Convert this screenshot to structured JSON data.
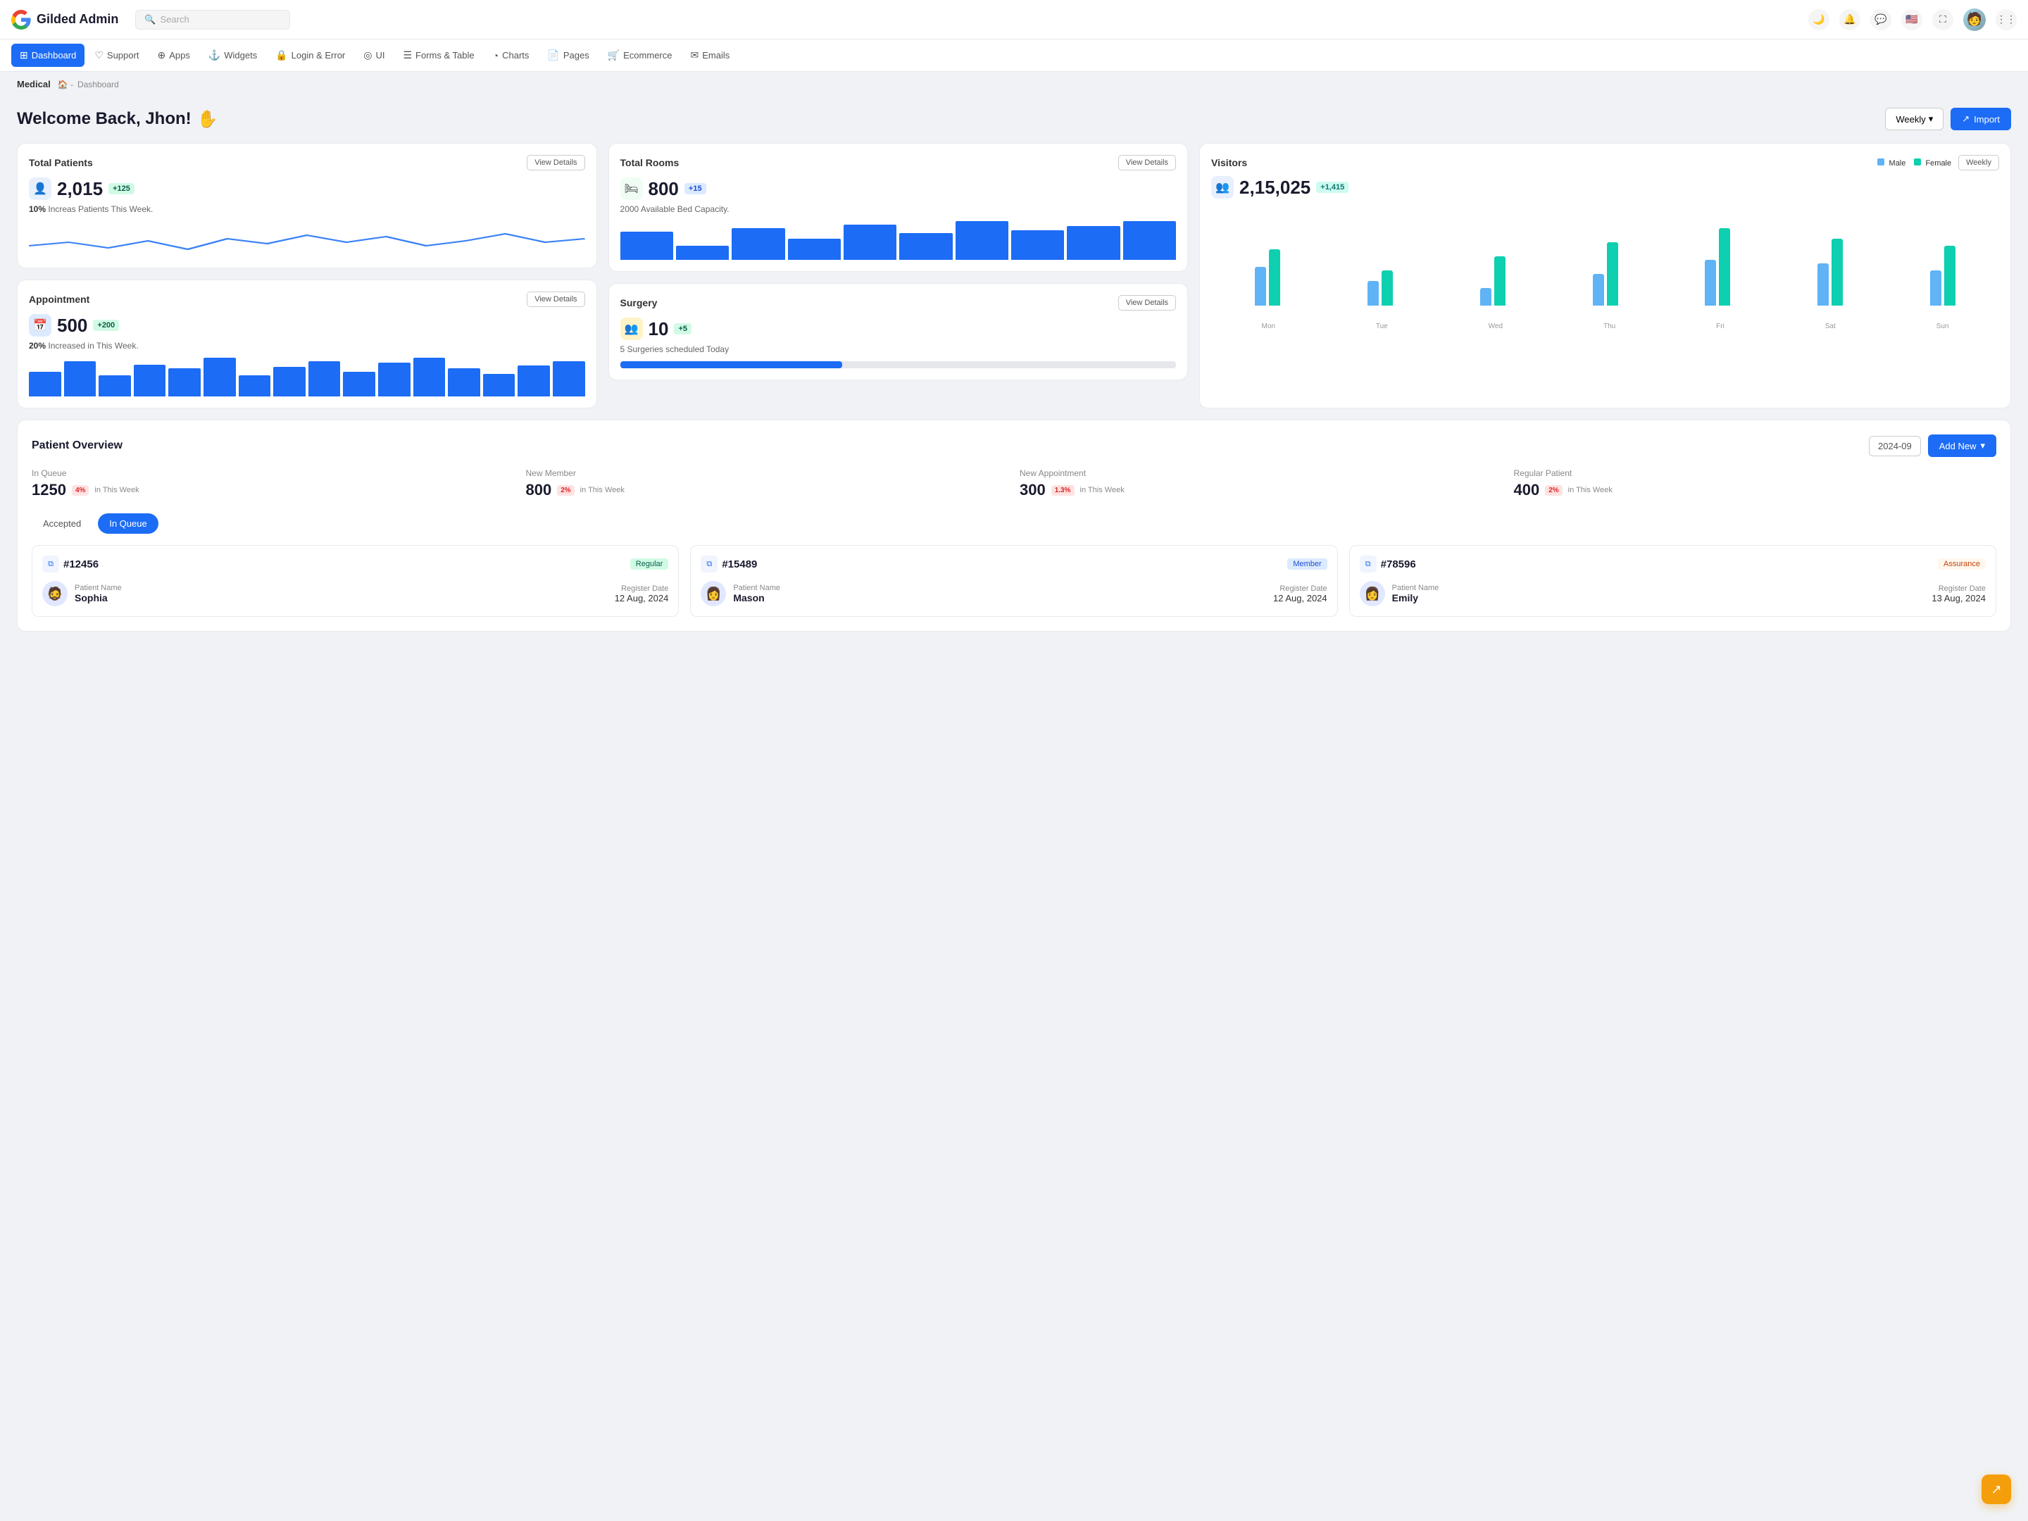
{
  "brand": {
    "name": "Gilded Admin"
  },
  "search": {
    "placeholder": "Search"
  },
  "navbar": {
    "icons": [
      "moon",
      "bell",
      "chat",
      "flag",
      "expand",
      "avatar",
      "grid"
    ]
  },
  "menu": {
    "items": [
      {
        "label": "Dashboard",
        "icon": "⊞",
        "active": true
      },
      {
        "label": "Support",
        "icon": "♡"
      },
      {
        "label": "Apps",
        "icon": "⊕"
      },
      {
        "label": "Widgets",
        "icon": "⚓"
      },
      {
        "label": "Login & Error",
        "icon": "🔒"
      },
      {
        "label": "UI",
        "icon": "◎"
      },
      {
        "label": "Forms & Table",
        "icon": "☰"
      },
      {
        "label": "Charts",
        "icon": "◔"
      },
      {
        "label": "Pages",
        "icon": "📄"
      },
      {
        "label": "Ecommerce",
        "icon": "🛒"
      },
      {
        "label": "Emails",
        "icon": "✉"
      }
    ]
  },
  "breadcrumb": {
    "section": "Medical",
    "path": [
      "Dashboard"
    ]
  },
  "welcome": {
    "title": "Welcome Back, Jhon!",
    "emoji": "✋",
    "weekly_label": "Weekly",
    "import_label": "Import"
  },
  "total_patients": {
    "title": "Total Patients",
    "view_details": "View Details",
    "number": "2,015",
    "badge": "+125",
    "sub_bold": "10%",
    "sub_text": " Increas Patients This Week."
  },
  "total_rooms": {
    "title": "Total Rooms",
    "view_details": "View Details",
    "number": "800",
    "badge": "+15",
    "sub_text": "2000 Available Bed Capacity."
  },
  "appointment": {
    "title": "Appointment",
    "view_details": "View Details",
    "number": "500",
    "badge": "+200",
    "sub_bold": "20%",
    "sub_text": " Increased in This Week."
  },
  "surgery": {
    "title": "Surgery",
    "view_details": "View Details",
    "number": "10",
    "badge": "+5",
    "sub_text": "5 Surgeries scheduled Today",
    "progress": 40
  },
  "visitors": {
    "title": "Visitors",
    "weekly_label": "Weekly",
    "number": "2,15,025",
    "badge": "+1,415",
    "legend_male": "Male",
    "legend_female": "Female",
    "male_color": "#60b3f5",
    "female_color": "#0ecfb0",
    "days": [
      "Mon",
      "Tue",
      "Wed",
      "Thu",
      "Fri",
      "Sat",
      "Sun"
    ],
    "male_heights": [
      55,
      35,
      25,
      45,
      65,
      60,
      50
    ],
    "female_heights": [
      80,
      50,
      70,
      90,
      110,
      95,
      85
    ]
  },
  "patient_overview": {
    "title": "Patient Overview",
    "date": "2024-09",
    "add_new_label": "Add New",
    "stats": [
      {
        "label": "In Queue",
        "number": "1250",
        "badge": "4%",
        "badge_type": "red",
        "sub": "in This Week"
      },
      {
        "label": "New Member",
        "number": "800",
        "badge": "2%",
        "badge_type": "red",
        "sub": "in This Week"
      },
      {
        "label": "New Appointment",
        "number": "300",
        "badge": "1.3%",
        "badge_type": "red",
        "sub": "in This Week"
      },
      {
        "label": "Regular Patient",
        "number": "400",
        "badge": "2%",
        "badge_type": "red",
        "sub": "in This Week"
      }
    ],
    "tabs": [
      {
        "label": "Accepted",
        "active": false
      },
      {
        "label": "In Queue",
        "active": true
      }
    ],
    "patients": [
      {
        "id": "#12456",
        "badge": "Regular",
        "badge_type": "regular",
        "name_label": "Patient Name",
        "name": "Sophia",
        "date_label": "Register Date",
        "date": "12 Aug, 2024",
        "avatar": "👨"
      },
      {
        "id": "#15489",
        "badge": "Member",
        "badge_type": "member",
        "name_label": "Patient Name",
        "name": "Mason",
        "date_label": "Register Date",
        "date": "12 Aug, 2024",
        "avatar": "👩"
      },
      {
        "id": "#78596",
        "badge": "Assurance",
        "badge_type": "assurance",
        "name_label": "Patient Name",
        "name": "Emily",
        "date_label": "Register Date",
        "date": "13 Aug, 2024",
        "avatar": "👩"
      }
    ]
  }
}
